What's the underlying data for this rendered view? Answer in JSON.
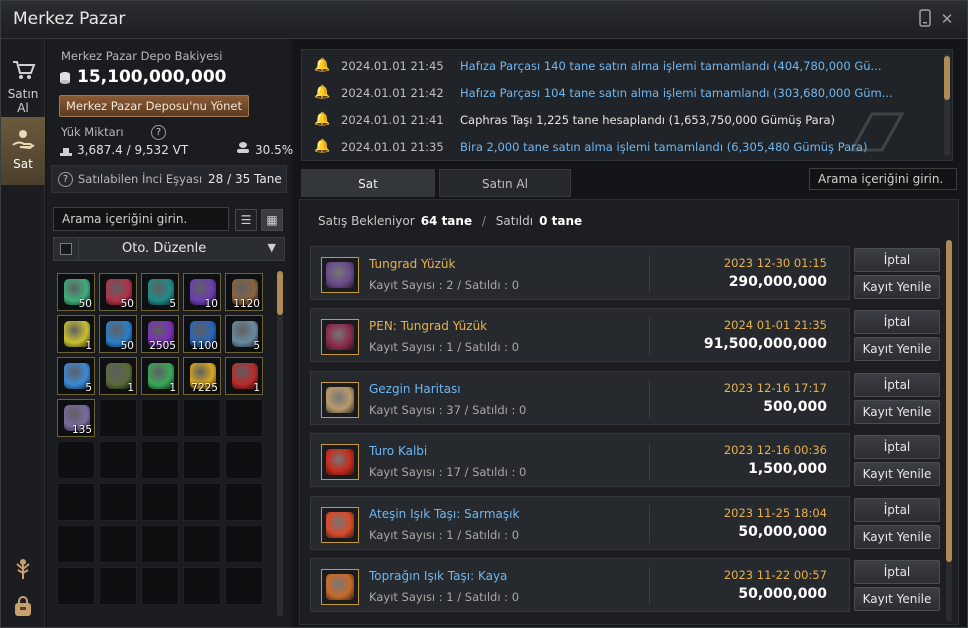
{
  "window": {
    "title": "Merkez Pazar"
  },
  "sidenav": {
    "buy": "Satın Al",
    "sell": "Sat"
  },
  "left": {
    "depot_label": "Merkez Pazar Depo Bakiyesi",
    "balance": "15,100,000,000",
    "manage_btn": "Merkez Pazar Deposu'nu Yönet",
    "load_label": "Yük Miktarı",
    "load_value": "3,687.4 / 9,532 VT",
    "load_percent": "30.5%",
    "inci_label": "Satılabilen İnci Eşyası",
    "inci_value": "28 / 35 Tane",
    "search_placeholder": "Arama içeriğini girin.",
    "sort_label": "Oto. Düzenle"
  },
  "inventory": [
    {
      "count": "50",
      "color": "#3fae7a"
    },
    {
      "count": "50",
      "color": "#b0324a"
    },
    {
      "count": "5",
      "color": "#1f8a86"
    },
    {
      "count": "10",
      "color": "#6a3fb0"
    },
    {
      "count": "1120",
      "color": "#8a6440"
    },
    {
      "count": "1",
      "color": "#c8c030"
    },
    {
      "count": "50",
      "color": "#2a7fc8"
    },
    {
      "count": "2505",
      "color": "#7a2fb8"
    },
    {
      "count": "1100",
      "color": "#2a64b8"
    },
    {
      "count": "5",
      "color": "#6a8aa0"
    },
    {
      "count": "5",
      "color": "#3a8ad8"
    },
    {
      "count": "1",
      "color": "#5a6a3a"
    },
    {
      "count": "1",
      "color": "#3aa85a"
    },
    {
      "count": "7225",
      "color": "#d8a820"
    },
    {
      "count": "1",
      "color": "#b82a2a"
    },
    {
      "count": "135",
      "color": "#7a6aa0"
    }
  ],
  "log": [
    {
      "time": "2024.01.01 21:45",
      "msg": "Hafıza Parçası 140 tane satın alma işlemi tamamlandı (404,780,000 Gü...",
      "color": "#6fb7f2"
    },
    {
      "time": "2024.01.01 21:42",
      "msg": "Hafıza Parçası 104 tane satın alma işlemi tamamlandı (303,680,000 Güm...",
      "color": "#6fb7f2"
    },
    {
      "time": "2024.01.01 21:41",
      "msg": "Caphras Taşı 1,225 tane hesaplandı (1,653,750,000 Gümüş Para)",
      "color": "#e6e6e6"
    },
    {
      "time": "2024.01.01 21:35",
      "msg": "Bira 2,000 tane satın alma işlemi tamamlandı (6,305,480 Gümüş Para)",
      "color": "#6fb7f2"
    }
  ],
  "tabs": {
    "sell": "Sat",
    "buy": "Satın Al"
  },
  "search_right": "Arama içeriğini girin.",
  "summary": {
    "waiting_label": "Satış Bekleniyor",
    "waiting_value": "64 tane",
    "sold_label": "Satıldı",
    "sold_value": "0 tane"
  },
  "buttons": {
    "cancel": "İptal",
    "renew": "Kayıt Yenile"
  },
  "listings": [
    {
      "name": "Tungrad Yüzük",
      "name_color": "#e8b24a",
      "sub": "Kayıt Sayısı : 2 / Satıldı : 0",
      "date": "2023 12-30 01:15",
      "price": "290,000,000",
      "icon_color": "#6a4a8a"
    },
    {
      "name": "PEN: Tungrad Yüzük",
      "name_color": "#e8b24a",
      "sub": "Kayıt Sayısı : 1 / Satıldı : 0",
      "date": "2024 01-01 21:35",
      "price": "91,500,000,000",
      "icon_color": "#8a2a4a"
    },
    {
      "name": "Gezgin Haritası",
      "name_color": "#6fb7f2",
      "sub": "Kayıt Sayısı : 37 / Satıldı : 0",
      "date": "2023 12-16 17:17",
      "price": "500,000",
      "icon_color": "#b89a6a"
    },
    {
      "name": "Turo Kalbi",
      "name_color": "#6fb7f2",
      "sub": "Kayıt Sayısı : 17 / Satıldı : 0",
      "date": "2023 12-16 00:36",
      "price": "1,500,000",
      "icon_color": "#c82a1a"
    },
    {
      "name": "Ateşin Işık Taşı: Sarmaşık",
      "name_color": "#6fb7f2",
      "sub": "Kayıt Sayısı : 1 / Satıldı : 0",
      "date": "2023 11-25 18:04",
      "price": "50,000,000",
      "icon_color": "#d84a2a"
    },
    {
      "name": "Toprağın Işık Taşı: Kaya",
      "name_color": "#6fb7f2",
      "sub": "Kayıt Sayısı : 1 / Satıldı : 0",
      "date": "2023 11-22 00:57",
      "price": "50,000,000",
      "icon_color": "#c86a2a"
    }
  ]
}
